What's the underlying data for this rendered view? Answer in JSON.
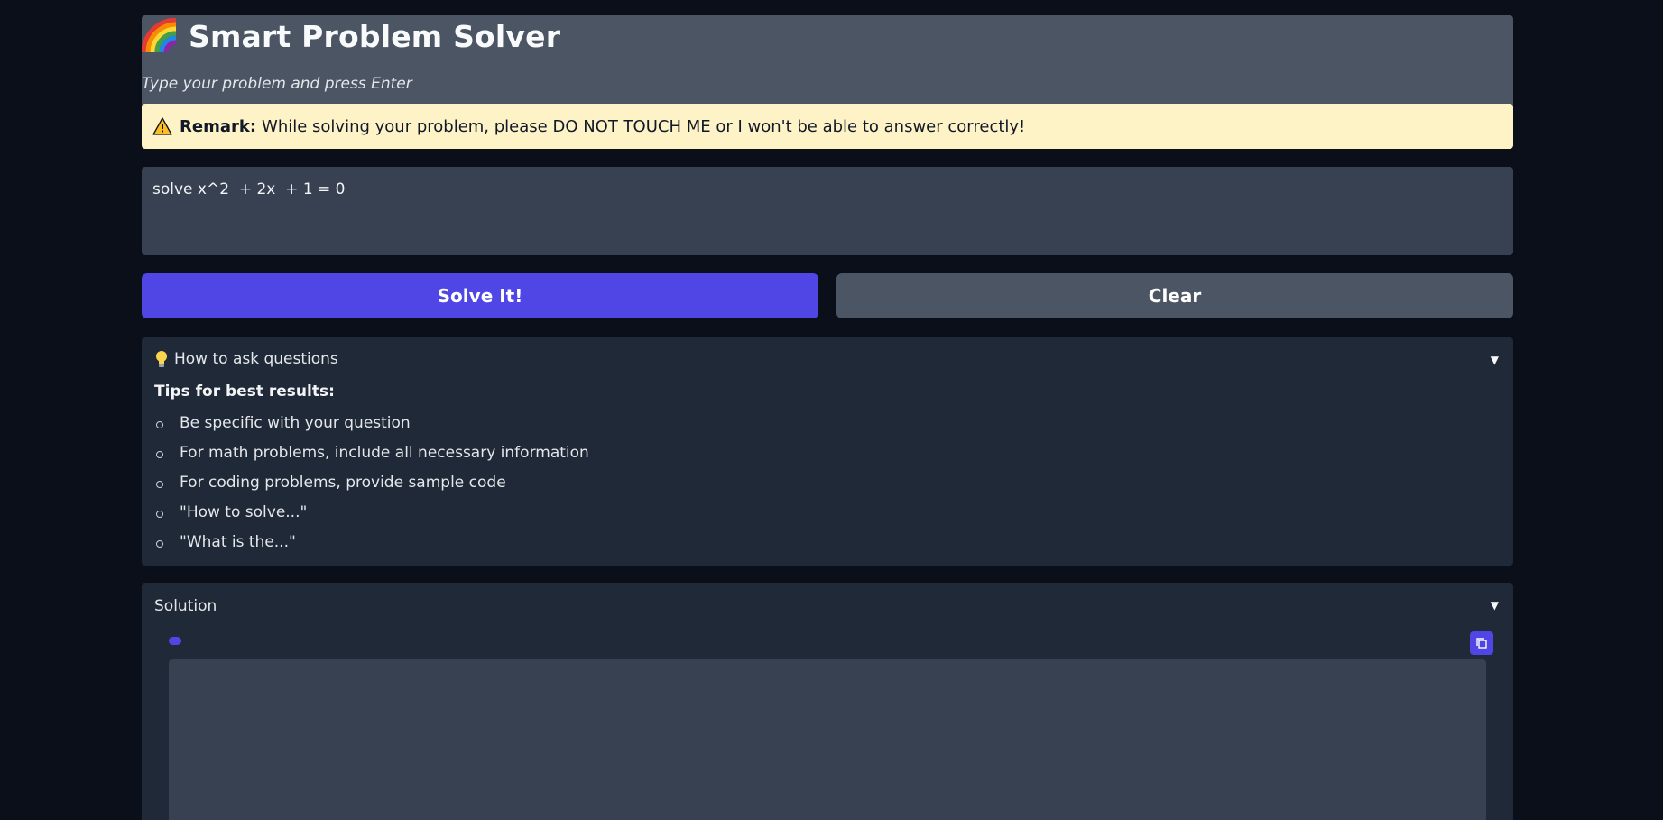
{
  "app": {
    "title": "Smart Problem Solver",
    "subtitle": "Type your problem and press Enter"
  },
  "remark": {
    "label": "Remark:",
    "text": "While solving your problem, please DO NOT TOUCH ME or I won't be able to answer correctly!"
  },
  "problem_input": {
    "value": "solve x^2  + 2x  + 1 = 0"
  },
  "buttons": {
    "solve_label": "Solve It!",
    "clear_label": "Clear"
  },
  "tips_accordion": {
    "header": "How to ask questions",
    "title": "Tips for best results:",
    "items": [
      "Be specific with your question",
      "For math problems, include all necessary information",
      "For coding problems, provide sample code",
      "\"How to solve...\"",
      "\"What is the...\""
    ]
  },
  "solution_accordion": {
    "header": "Solution"
  },
  "colors": {
    "background": "#0b0f19",
    "header_panel": "#4b5563",
    "remark_bg": "#fef3c7",
    "accent": "#4f46e5",
    "panel": "#1f2937",
    "input_bg": "#374151"
  },
  "icons": {
    "title_icon": "rainbow-icon",
    "remark_icon": "warning-icon",
    "tips_icon": "lightbulb-icon",
    "caret_icon": "caret-down-icon",
    "copy_icon": "copy-icon"
  }
}
